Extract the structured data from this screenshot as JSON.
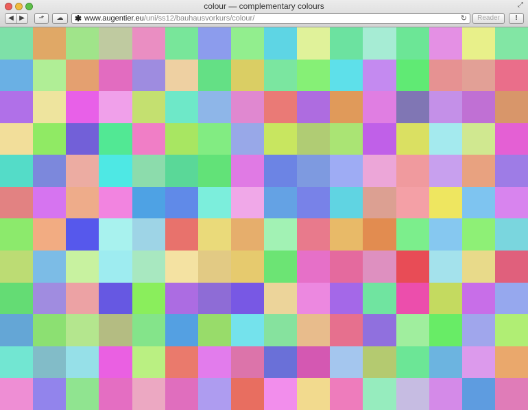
{
  "window": {
    "title": "colour — complementary colours",
    "traffic_lights": [
      "#ec5f5b",
      "#f0bc3e",
      "#5dc049"
    ],
    "fullscreen_icon": "fullscreen-icon"
  },
  "toolbar": {
    "back_icon": "◀",
    "forward_icon": "▶",
    "share_icon": "⬏",
    "cloud_icon": "☁",
    "address": {
      "bookmark_icon": "✱",
      "domain": "www.augentier.eu",
      "path": "/uni/ss12/bauhausvorkurs/colour/",
      "reload_icon": "↻"
    },
    "reader_label": "Reader",
    "download_icon": "!"
  },
  "swatches": [
    [
      "#7ee0a8",
      "#e0a866",
      "#a0e48a",
      "#bfcaa0",
      "#ea8ec2",
      "#78e69a",
      "#8c9ced",
      "#92ee8e",
      "#5ed5e4",
      "#e0f29a",
      "#6ce2a0",
      "#a6ecd4",
      "#6ce696",
      "#e490e4",
      "#e8f08a",
      "#82e6a4"
    ],
    [
      "#6ab0e4",
      "#b0ee96",
      "#e4a070",
      "#e26cc0",
      "#9e8ce0",
      "#eed0a2",
      "#64e085",
      "#dace64",
      "#7be6a0",
      "#86f076",
      "#5ee0ea",
      "#c48af0",
      "#60ea74",
      "#e69292",
      "#e2a096",
      "#ea6e8a"
    ],
    [
      "#b070e8",
      "#eee49e",
      "#e860e8",
      "#f0a0ea",
      "#c4e070",
      "#6ee8c8",
      "#8eb6e8",
      "#e088d0",
      "#ea7a76",
      "#ae6ce0",
      "#e09a5a",
      "#e07ee2",
      "#8076b4",
      "#c490e8",
      "#c070d4",
      "#d8966a"
    ],
    [
      "#f2de9a",
      "#90ea64",
      "#7260d8",
      "#52e894",
      "#f07ec6",
      "#a8e662",
      "#82ec82",
      "#98a8e8",
      "#c8e660",
      "#b0cc74",
      "#aae474",
      "#c060e8",
      "#dae062",
      "#a4eaee",
      "#d0e890",
      "#e460d4"
    ],
    [
      "#54dcc8",
      "#7c88dc",
      "#ecaca2",
      "#4ee8e4",
      "#8cdcac",
      "#5ad898",
      "#62e278",
      "#e07ae4",
      "#6c84e4",
      "#7e9ae0",
      "#9eacf4",
      "#eca6d8",
      "#f09a9e",
      "#c8a0ee",
      "#e8a280",
      "#9e7ce6"
    ],
    [
      "#e28282",
      "#d674f0",
      "#eeac8a",
      "#f284e0",
      "#4ea2e4",
      "#608ae8",
      "#7ceedc",
      "#f0a8e8",
      "#64a2e4",
      "#7882e8",
      "#60d4e2",
      "#dca092",
      "#f4a0a6",
      "#eee660",
      "#7ec4f0",
      "#d884ee"
    ],
    [
      "#8cea6c",
      "#f2ac82",
      "#5658ec",
      "#a8f2ee",
      "#9ed4e6",
      "#e8726c",
      "#eada7a",
      "#e6ae6c",
      "#a2f2b4",
      "#e87a8c",
      "#e8ba68",
      "#e28c50",
      "#7cee8c",
      "#86c8f0",
      "#8ef076",
      "#7ad6de"
    ],
    [
      "#bcdc74",
      "#7cbce6",
      "#c8f2a0",
      "#9eecf0",
      "#a8e8c0",
      "#f4e2a2",
      "#e2ca84",
      "#e6ca6e",
      "#6ce474",
      "#e670c8",
      "#e46a9e",
      "#de90c0",
      "#e84c56",
      "#a4e2ec",
      "#e8da8a",
      "#e0607c"
    ],
    [
      "#64dc74",
      "#a08ce0",
      "#eca2a4",
      "#6658e2",
      "#8aee5c",
      "#ac6ce2",
      "#8e6cd6",
      "#7858e4",
      "#ecd49a",
      "#ec88e0",
      "#a468e8",
      "#70e4a0",
      "#ec4eac",
      "#c4da60",
      "#c86ee8",
      "#96a8ee"
    ],
    [
      "#64a6d6",
      "#8ce072",
      "#b4e68e",
      "#b4bc82",
      "#84e48a",
      "#54a0e2",
      "#98dc6a",
      "#74e2ec",
      "#86e29e",
      "#e8bc8c",
      "#e6708e",
      "#9070de",
      "#a0ee9e",
      "#68ec66",
      "#a0a6ec",
      "#b0ee74"
    ],
    [
      "#72e6d2",
      "#82bcc8",
      "#96e0e8",
      "#ea60e2",
      "#baf082",
      "#ea7a6c",
      "#e27cec",
      "#dc74aa",
      "#6a70d8",
      "#d458b2",
      "#a4c6ee",
      "#b4ca70",
      "#6ce696",
      "#6cb4e0",
      "#dc9aec",
      "#eaa86c"
    ],
    [
      "#ee8ed4",
      "#9284ec",
      "#90e490",
      "#e46ec2",
      "#eca8c2",
      "#e06ebe",
      "#ae9cf0",
      "#e86e60",
      "#f28eec",
      "#f2da8e",
      "#ee7cbc",
      "#96ecbe",
      "#c6bce2",
      "#d48ae8",
      "#5e9ce0",
      "#e07cb8"
    ]
  ]
}
